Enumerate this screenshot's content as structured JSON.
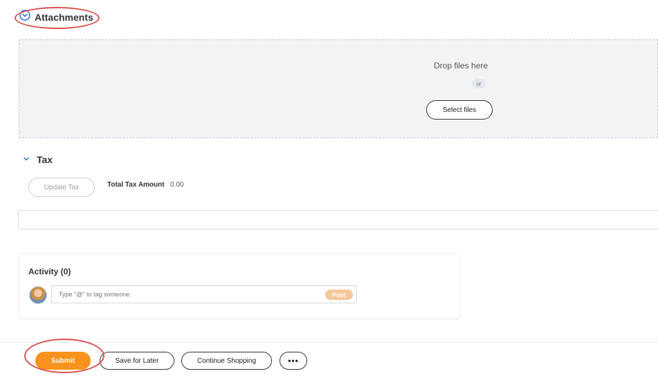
{
  "attachments": {
    "title": "Attachments",
    "drop_label": "Drop files here",
    "or_label": "or",
    "select_files_label": "Select files"
  },
  "tax": {
    "title": "Tax",
    "update_tax_label": "Update Tax",
    "total_tax_label": "Total Tax Amount",
    "total_tax_value": "0.00"
  },
  "activity": {
    "title": "Activity (0)",
    "comment_placeholder": "Type \"@\" to tag someone.",
    "post_label": "Post"
  },
  "footer": {
    "submit_label": "Submit",
    "save_label": "Save for Later",
    "continue_label": "Continue Shopping",
    "more_label": "•••"
  },
  "colors": {
    "accent_blue": "#1a6fd1",
    "submit_orange": "#f7931e",
    "post_disabled": "#f7c89a",
    "annotation_red": "#d9534f"
  },
  "icons": {
    "attachments_toggle": "chevron-down-circle-icon",
    "tax_toggle": "chevron-down-icon",
    "avatar": "user-avatar"
  }
}
